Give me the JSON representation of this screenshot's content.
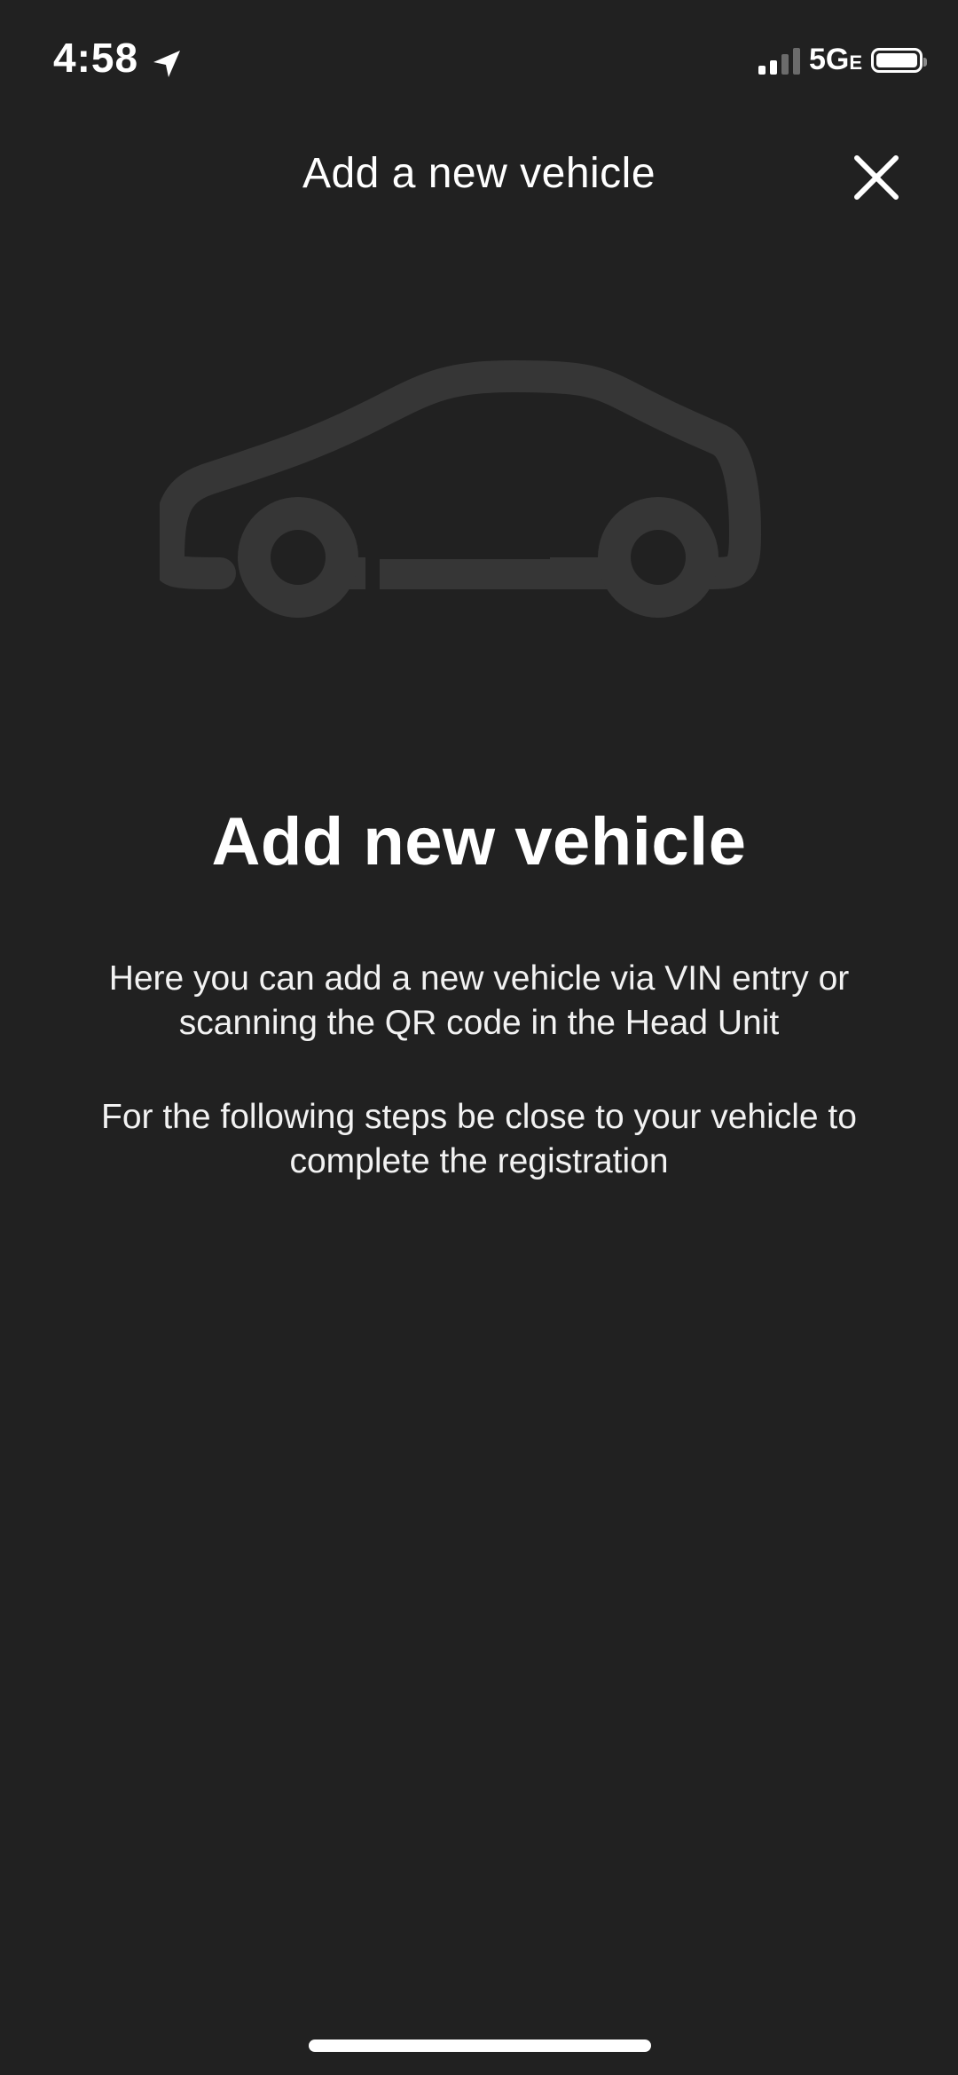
{
  "status_bar": {
    "time": "4:58",
    "network": "5G",
    "network_suffix": "E"
  },
  "header": {
    "title": "Add a new vehicle"
  },
  "icons": {
    "location": "location-arrow-icon",
    "close": "close-icon",
    "vehicle": "car-illustration",
    "battery": "battery-icon",
    "signal": "signal-strength-icon"
  },
  "main": {
    "title": "Add new vehicle",
    "description_1": "Here you can add a new vehicle via VIN entry or scanning the QR code in the Head Unit",
    "description_2": "For the following steps be close to your vehicle to complete the registration"
  },
  "colors": {
    "background": "#212121",
    "text": "#ffffff",
    "illustration": "#363636"
  }
}
